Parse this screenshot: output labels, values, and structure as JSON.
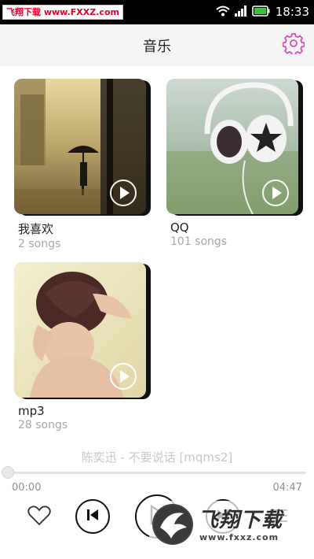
{
  "status_bar": {
    "watermark": "飞翔下载 www.FXXZ.com",
    "time": "18:33",
    "icons": [
      "wifi-icon",
      "signal-icon",
      "battery-icon"
    ]
  },
  "header": {
    "title": "音乐",
    "settings_icon": "gear-icon"
  },
  "playlists": [
    {
      "name": "我喜欢",
      "count": "2 songs"
    },
    {
      "name": "QQ",
      "count": "101 songs"
    },
    {
      "name": "mp3",
      "count": "28 songs"
    }
  ],
  "player": {
    "now_playing": "陈奕迅 - 不要说话 [mqms2]",
    "time_current": "00:00",
    "time_total": "04:47",
    "progress": 0.0
  },
  "watermark_br": {
    "text": "飞翔下载",
    "url": "www.fxxz.com"
  },
  "colors": {
    "accent": "#d34fb6",
    "header_bg": "#f4f4f4",
    "muted_text": "#a7a7a7"
  }
}
